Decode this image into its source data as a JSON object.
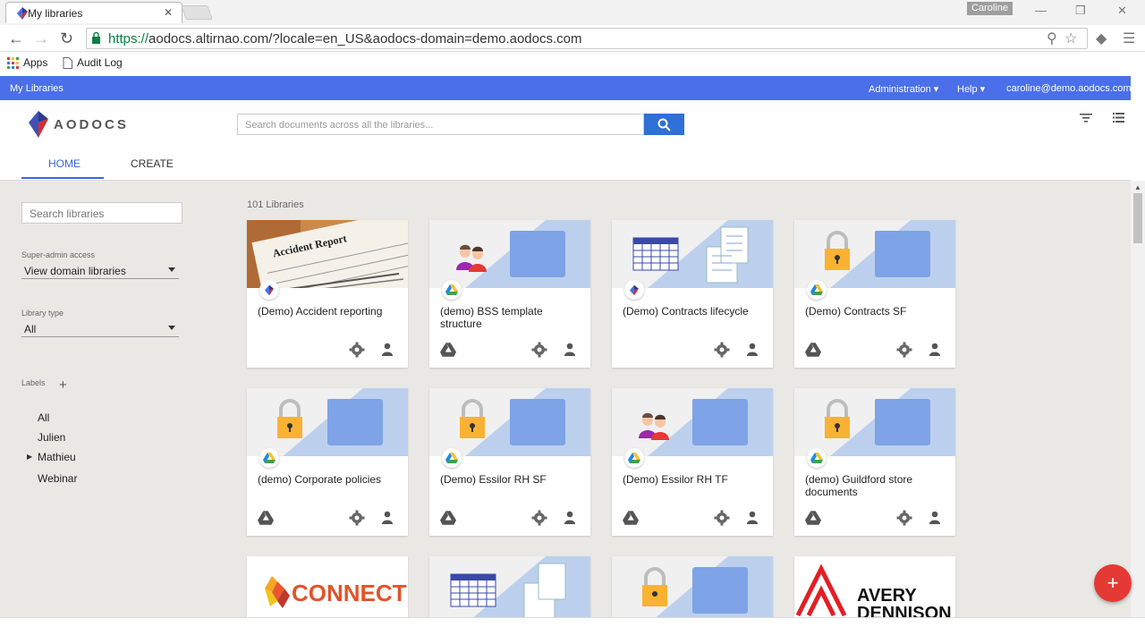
{
  "browser": {
    "tab_title": "My libraries",
    "tab_close": "✕",
    "profile_name": "Caroline",
    "url_https": "https://",
    "url_rest": "aodocs.altirnao.com/?locale=en_US&aodocs-domain=demo.aodocs.com",
    "bookmarks": {
      "apps": "Apps",
      "audit_log": "Audit Log"
    }
  },
  "topbar": {
    "title": "My Libraries",
    "administration": "Administration",
    "help": "Help",
    "user": "caroline@demo.aodocs.com",
    "accent_color": "#4a6fe8"
  },
  "header": {
    "logo_text": "AODOCS",
    "search_placeholder": "Search documents across all the libraries...",
    "tabs": {
      "home": "HOME",
      "create": "CREATE"
    }
  },
  "sidebar": {
    "search_placeholder": "Search libraries",
    "superadmin_label": "Super-admin access",
    "superadmin_value": "View domain libraries",
    "library_type_label": "Library type",
    "library_type_value": "All",
    "labels_heading": "Labels",
    "labels": [
      "All",
      "Julien",
      "Mathieu",
      "Webinar"
    ]
  },
  "main": {
    "count": "101 Libraries",
    "cards": [
      {
        "title": "(Demo) Accident reporting",
        "image": "accident-report-photo",
        "badge": "aodocs-icon"
      },
      {
        "title": "(demo) BSS template structure",
        "image": "people-folder",
        "badge": "drive-icon"
      },
      {
        "title": "(Demo) Contracts lifecycle",
        "image": "calendar-docs",
        "badge": "aodocs-icon"
      },
      {
        "title": "(Demo) Contracts SF",
        "image": "lock-folder",
        "badge": "drive-icon"
      },
      {
        "title": "(demo) Corporate policies",
        "image": "lock-folder",
        "badge": "drive-icon"
      },
      {
        "title": "(Demo) Essilor RH SF",
        "image": "lock-folder",
        "badge": "drive-icon"
      },
      {
        "title": "(Demo) Essilor RH TF",
        "image": "people-folder",
        "badge": "drive-icon"
      },
      {
        "title": "(demo) Guildford store documents",
        "image": "lock-folder",
        "badge": "drive-icon"
      }
    ],
    "partial_cards": [
      {
        "logo_text": "CONNECT",
        "image": "connect-logo"
      },
      {
        "image": "calendar-docs"
      },
      {
        "image": "lock-folder"
      },
      {
        "logo_text_1": "AVERY",
        "logo_text_2": "DENNISON",
        "image": "avery-logo"
      }
    ]
  },
  "fab_label": "+",
  "accident_report_text": "Accident Report"
}
